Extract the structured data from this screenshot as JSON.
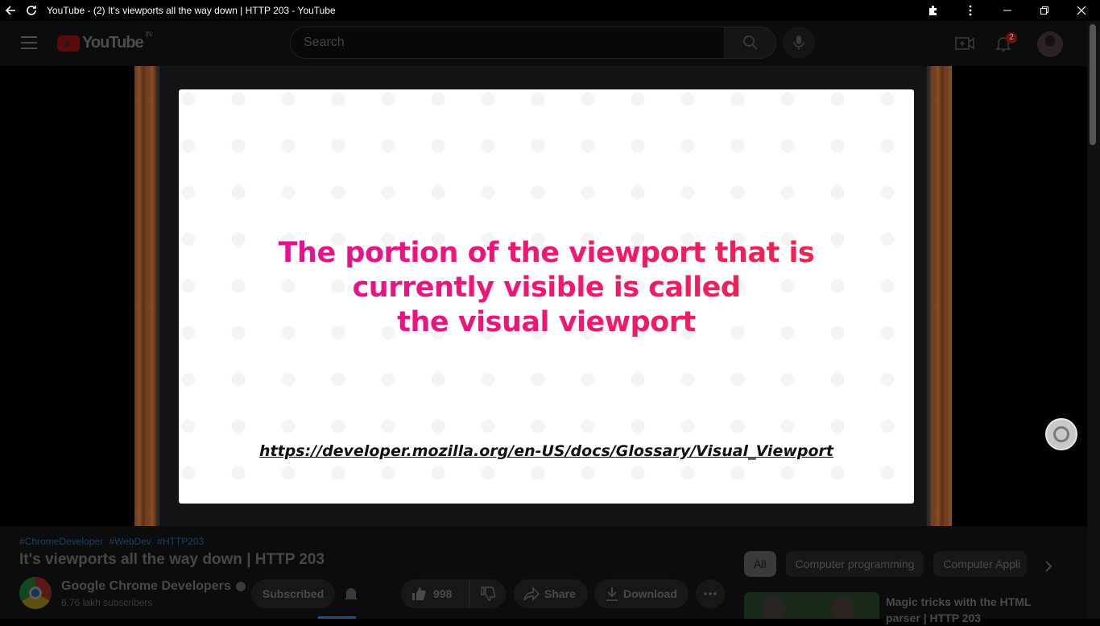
{
  "window": {
    "title": "YouTube - (2) It's viewports all the way down | HTTP 203 - YouTube"
  },
  "masthead": {
    "logo_text": "YouTube",
    "region": "IN",
    "search_placeholder": "Search",
    "notification_count": "2"
  },
  "player": {
    "slide_headline_lines": [
      "The portion of the viewport that is",
      "currently visible is called",
      "the visual viewport"
    ],
    "slide_url": "https://developer.mozilla.org/en-US/docs/Glossary/Visual_Viewport"
  },
  "video": {
    "hashtags": [
      "#ChromeDeveloper",
      "#WebDev",
      "#HTTP203"
    ],
    "title": "It's viewports all the way down | HTTP 203",
    "channel_name": "Google Chrome Developers",
    "subscribers": "6.76 lakh subscribers",
    "subscribe_label": "Subscribed",
    "like_count": "998",
    "share_label": "Share",
    "download_label": "Download"
  },
  "chips": [
    "All",
    "Computer programming",
    "Computer Appli"
  ],
  "recommendation": {
    "title": "Magic tricks with the HTML parser | HTTP 203"
  },
  "colors": {
    "slide_gradient_start": "#e0109a",
    "slide_gradient_end": "#f0283c",
    "wood": "#7b4423"
  }
}
